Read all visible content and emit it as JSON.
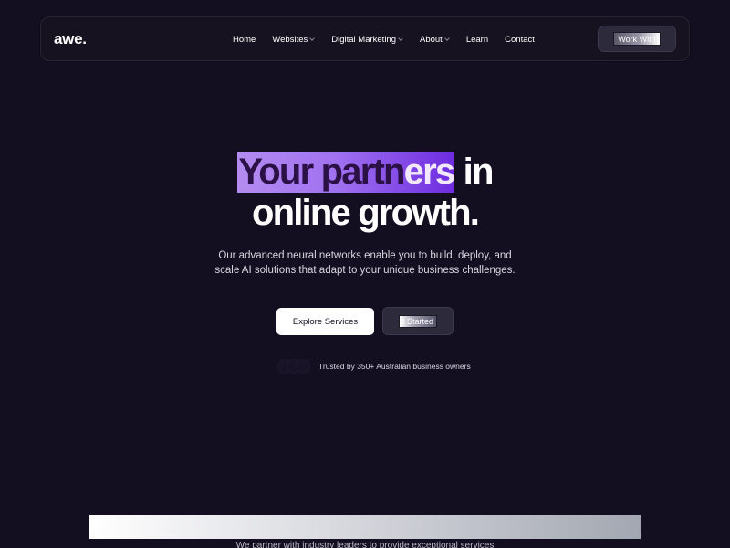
{
  "nav": {
    "logo": "awe.",
    "links": [
      {
        "label": "Home",
        "has_dropdown": false
      },
      {
        "label": "Websites",
        "has_dropdown": true
      },
      {
        "label": "Digital Marketing",
        "has_dropdown": true
      },
      {
        "label": "About",
        "has_dropdown": true
      },
      {
        "label": "Learn",
        "has_dropdown": false
      },
      {
        "label": "Contact",
        "has_dropdown": false
      }
    ],
    "cta_label": "Work With"
  },
  "hero": {
    "title_highlight_a": "Your partn",
    "title_highlight_b": "ers",
    "title_line1_rest": " in",
    "title_line2": "online growth.",
    "description": "Our advanced neural networks enable you to build, deploy, and scale AI solutions that adapt to your unique business challenges.",
    "primary_button": "Explore Services",
    "secondary_button": "t Started",
    "trusted_text": "Trusted by 350+ Australian business owners"
  },
  "partners": {
    "text": "We partner with industry leaders to provide exceptional services"
  },
  "colors": {
    "background": "#140f20",
    "highlight_start": "#b48cf0",
    "highlight_end": "#6e2ce0",
    "primary_button_bg": "#ffffff"
  },
  "icons": [
    "chevron-down-icon"
  ]
}
